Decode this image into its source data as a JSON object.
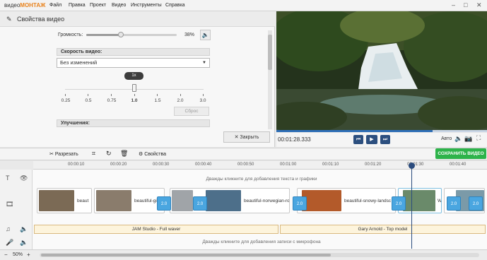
{
  "app": {
    "brand_a": "видео",
    "brand_b": "МОНТАЖ"
  },
  "menu": [
    "Файл",
    "Правка",
    "Проект",
    "Видео",
    "Инструменты",
    "Справка"
  ],
  "panel": {
    "title": "Свойства видео",
    "volume_label": "Громкость:",
    "volume_value": "38%",
    "volume_level": 0.38,
    "speed_section": "Скорость видео:",
    "speed_select": "Без изменений",
    "speed_badge": "1x",
    "speed_ticks": [
      "0.25",
      "0.5",
      "0.75",
      "1.0",
      "1.5",
      "2.0",
      "3.0"
    ],
    "reset": "Сброс",
    "improve_section": "Улучшения:",
    "close": "Закрыть"
  },
  "player": {
    "time": "00:01:28.333",
    "quality": "Авто",
    "progress": 0.74
  },
  "save_button": "СОХРАНИТЬ ВИДЕО",
  "toolbar": {
    "cut": "Разрезать",
    "props": "Свойства"
  },
  "ruler": [
    "00:00:10",
    "00:00:20",
    "00:00:30",
    "00:00:40",
    "00:00:50",
    "00:01:00",
    "00:01:10",
    "00:01:20",
    "00:01:30",
    "00:01:40"
  ],
  "tracks": {
    "text_hint": "Дважды кликните для добавления текста и графики",
    "mic_hint": "Дважды кликните для добавления записи с микрофона",
    "clips": [
      "beaut",
      "beautiful-gir",
      "beautiful-norwegian-rock",
      "beautiful-snowy-landsc",
      "Wi"
    ],
    "transition_label": "2.0",
    "audio1": "JAM Studio - Full waver",
    "audio2": "Gary Arnold - Top model"
  },
  "zoom": "50%",
  "colors": {
    "accent": "#e8821c",
    "save": "#2db34a",
    "control": "#2c4f7f"
  }
}
